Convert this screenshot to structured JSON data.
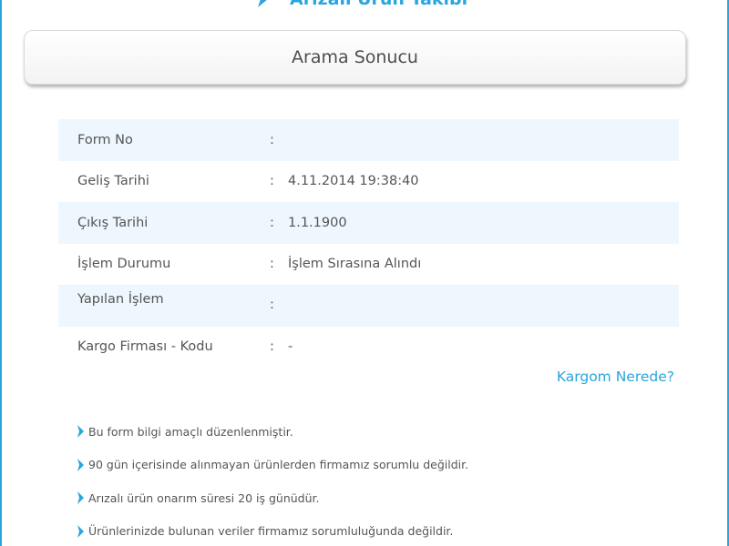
{
  "header": {
    "title": "Arızalı Ürün Takibi"
  },
  "result": {
    "title": "Arama Sonucu"
  },
  "details": [
    {
      "label": "Form No",
      "value": ""
    },
    {
      "label": "Geliş Tarihi",
      "value": "4.11.2014 19:38:40"
    },
    {
      "label": "Çıkış Tarihi",
      "value": "1.1.1900"
    },
    {
      "label": "İşlem Durumu",
      "value": "İşlem Sırasına Alındı"
    },
    {
      "label": "Yapılan İşlem",
      "value": ""
    },
    {
      "label": "Kargo Firması - Kodu",
      "value": "-"
    }
  ],
  "separator": ":",
  "link": {
    "label": "Kargom Nerede?"
  },
  "notes": [
    "Bu form bilgi amaçlı düzenlenmiştir.",
    "90 gün içerisinde alınmayan ürünlerden firmamız sorumlu değildir.",
    "Arızalı ürün onarım süresi 20 iş günüdür.",
    "Ürünlerinizde bulunan veriler firmamız sorumluluğunda değildir."
  ],
  "icons": {
    "bullet": "chevron-right-icon",
    "title": "chevron-right-icon"
  },
  "colors": {
    "accent": "#29a6dc",
    "row_alt_bg": "#eef7fd",
    "text": "#555555"
  }
}
